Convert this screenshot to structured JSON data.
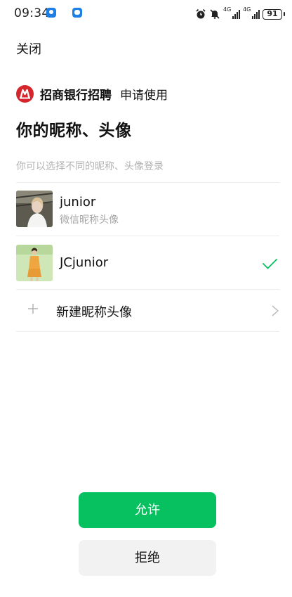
{
  "status_bar": {
    "time": "09:34",
    "net1": "4G",
    "net2": "4G",
    "battery": "91"
  },
  "header": {
    "close_label": "关闭"
  },
  "app": {
    "name": "招商银行招聘",
    "request": "申请使用",
    "logo_color": "#d6262c"
  },
  "page": {
    "title": "你的昵称、头像",
    "hint": "你可以选择不同的昵称、头像登录"
  },
  "profiles": [
    {
      "name": "junior",
      "subtitle": "微信昵称头像",
      "selected": false
    },
    {
      "name": "JCjunior",
      "selected": true
    }
  ],
  "new_profile": {
    "label": "新建昵称头像"
  },
  "actions": {
    "allow_label": "允许",
    "deny_label": "拒绝"
  },
  "colors": {
    "accent": "#07c160",
    "secondary_button": "#f2f2f2"
  }
}
